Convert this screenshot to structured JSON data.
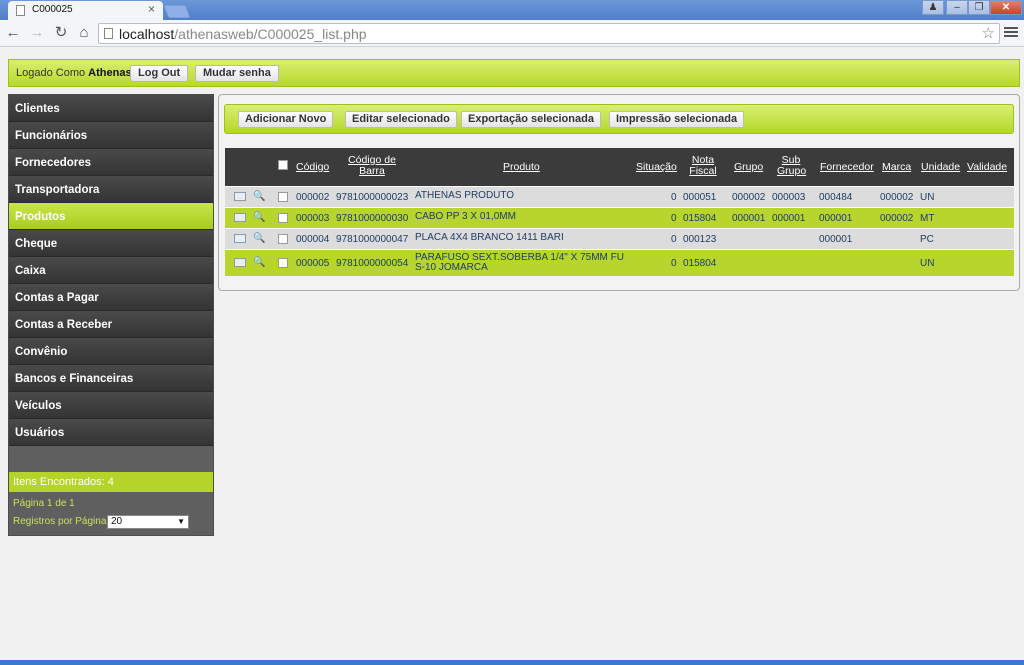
{
  "browser": {
    "tab_title": "C000025",
    "tab_close": "×",
    "url_host": "localhost",
    "url_path": "/athenasweb/C000025_list.php"
  },
  "header": {
    "logged_prefix": "Logado Como",
    "user": "Athenas",
    "logout_label": "Log Out",
    "change_password_label": "Mudar senha"
  },
  "sidebar": {
    "items": [
      {
        "label": "Clientes"
      },
      {
        "label": "Funcionários"
      },
      {
        "label": "Fornecedores"
      },
      {
        "label": "Transportadora"
      },
      {
        "label": "Produtos"
      },
      {
        "label": "Cheque"
      },
      {
        "label": "Caixa"
      },
      {
        "label": "Contas a Pagar"
      },
      {
        "label": "Contas a Receber"
      },
      {
        "label": "Convênio"
      },
      {
        "label": "Bancos e Financeiras"
      },
      {
        "label": "Veículos"
      },
      {
        "label": "Usuários"
      }
    ],
    "active_index": 4,
    "items_found": "Itens Encontrados: 4",
    "page_info": "Página 1 de 1",
    "per_page_label": "Registros por Página:",
    "per_page_value": "20"
  },
  "toolbar": {
    "add_label": "Adicionar Novo",
    "edit_label": "Editar selecionado",
    "export_label": "Exportação selecionada",
    "print_label": "Impressão selecionada"
  },
  "table": {
    "columns": {
      "codigo": "Código",
      "codigo_barra_1": "Código de",
      "codigo_barra_2": "Barra",
      "produto": "Produto",
      "situacao": "Situação",
      "nota_1": "Nota",
      "nota_2": "Fiscal",
      "grupo": "Grupo",
      "sub_1": "Sub",
      "sub_2": "Grupo",
      "fornecedor": "Fornecedor",
      "marca": "Marca",
      "unidade": "Unidade",
      "validade": "Validade"
    },
    "rows": [
      {
        "codigo": "000002",
        "barra": "9781000000023",
        "produto": "ATHENAS PRODUTO",
        "situacao": "0",
        "nota": "000051",
        "grupo": "000002",
        "subgrupo": "000003",
        "fornecedor": "000484",
        "marca": "000002",
        "unidade": "UN",
        "validade": ""
      },
      {
        "codigo": "000003",
        "barra": "9781000000030",
        "produto": "CABO PP 3 X 01,0MM",
        "situacao": "0",
        "nota": "015804",
        "grupo": "000001",
        "subgrupo": "000001",
        "fornecedor": "000001",
        "marca": "000002",
        "unidade": "MT",
        "validade": ""
      },
      {
        "codigo": "000004",
        "barra": "9781000000047",
        "produto": "PLACA 4X4 BRANCO 1411 BARI",
        "situacao": "0",
        "nota": "000123",
        "grupo": "",
        "subgrupo": "",
        "fornecedor": "000001",
        "marca": "",
        "unidade": "PC",
        "validade": ""
      },
      {
        "codigo": "000005",
        "barra": "9781000000054",
        "produto": "PARAFUSO SEXT.SOBERBA 1/4\" X 75MM FU S-10 JOMARCA",
        "situacao": "0",
        "nota": "015804",
        "grupo": "",
        "subgrupo": "",
        "fornecedor": "",
        "marca": "",
        "unidade": "UN",
        "validade": ""
      }
    ]
  }
}
